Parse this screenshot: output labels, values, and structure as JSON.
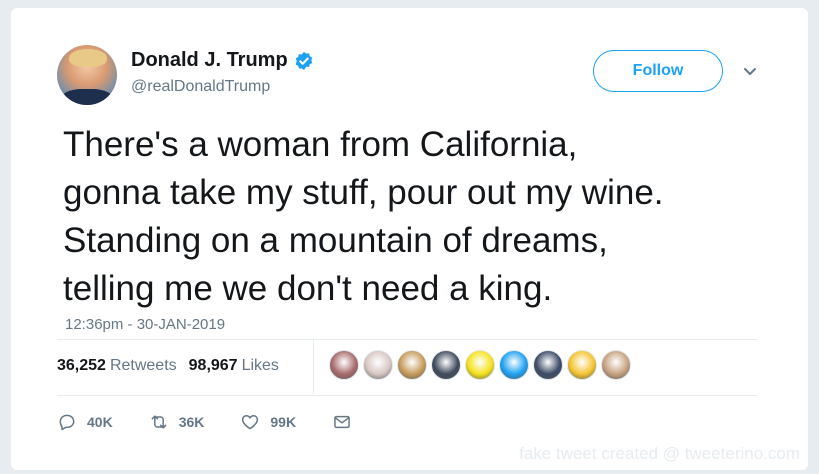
{
  "author": {
    "name": "Donald J. Trump",
    "handle": "@realDonaldTrump",
    "verified": true
  },
  "follow_button": {
    "label": "Follow",
    "color": "#1da1f2"
  },
  "tweet": {
    "text": "There's a woman from California,\ngonna take my stuff, pour out my wine.\nStanding on a mountain of dreams,\ntelling me we don't need a king.",
    "timestamp": "12:36pm - 30-JAN-2019"
  },
  "stats": {
    "retweets_count": "36,252",
    "retweets_label": "Retweets",
    "likes_count": "98,967",
    "likes_label": "Likes"
  },
  "likers": [
    {
      "color": "#a86b6b"
    },
    {
      "color": "#d8c7c2"
    },
    {
      "color": "#c69b5b"
    },
    {
      "color": "#3f4a5c"
    },
    {
      "color": "#f5e11a"
    },
    {
      "color": "#1da1f2"
    },
    {
      "color": "#3c4b67"
    },
    {
      "color": "#f4c430"
    },
    {
      "color": "#c6a27f"
    }
  ],
  "actions": {
    "reply_count": "40K",
    "retweet_count": "36K",
    "like_count": "99K"
  },
  "watermark": "fake tweet created @ tweeterino.com"
}
